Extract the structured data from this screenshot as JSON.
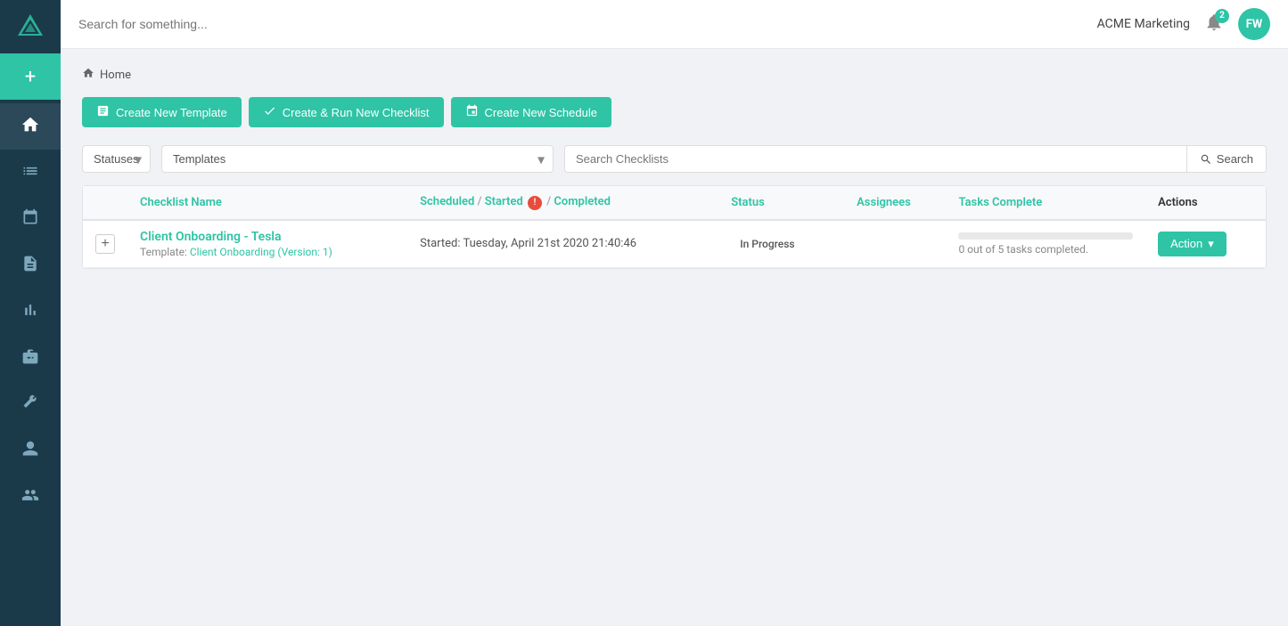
{
  "app": {
    "logo_icon": "▲",
    "add_icon": "+"
  },
  "sidebar": {
    "items": [
      {
        "id": "home",
        "icon": "⌂",
        "active": true
      },
      {
        "id": "list",
        "icon": "☰",
        "active": false
      },
      {
        "id": "calendar",
        "icon": "📅",
        "active": false
      },
      {
        "id": "notes",
        "icon": "📋",
        "active": false
      },
      {
        "id": "chart",
        "icon": "📊",
        "active": false
      },
      {
        "id": "briefcase",
        "icon": "💼",
        "active": false
      },
      {
        "id": "wrench",
        "icon": "🔧",
        "active": false
      },
      {
        "id": "person",
        "icon": "👤",
        "active": false
      },
      {
        "id": "group",
        "icon": "👥",
        "active": false
      }
    ]
  },
  "topbar": {
    "search_placeholder": "Search for something...",
    "org_name": "ACME Marketing",
    "notif_count": "2",
    "avatar_initials": "FW"
  },
  "breadcrumb": {
    "home_label": "Home"
  },
  "buttons": {
    "create_template": "Create New Template",
    "create_checklist": "Create & Run New Checklist",
    "create_schedule": "Create New Schedule"
  },
  "filters": {
    "status_placeholder": "Statuses",
    "templates_placeholder": "Templates",
    "search_placeholder": "Search Checklists",
    "search_button": "Search"
  },
  "table": {
    "columns": {
      "checklist_name": "Checklist Name",
      "scheduled": "Scheduled",
      "started": "Started",
      "completed": "Completed",
      "status": "Status",
      "assignees": "Assignees",
      "tasks_complete": "Tasks Complete",
      "actions": "Actions"
    },
    "rows": [
      {
        "id": 1,
        "name": "Client Onboarding - Tesla",
        "template_label": "Template:",
        "template_name": "Client Onboarding (Version: 1)",
        "scheduled": "",
        "started": "Started: Tuesday, April 21st 2020 21:40:46",
        "completed": "",
        "status": "In Progress",
        "assignees": "",
        "tasks_done": 0,
        "tasks_total": 5,
        "tasks_text": "0 out of 5 tasks completed.",
        "progress_pct": 0,
        "action_label": "Action"
      }
    ]
  }
}
